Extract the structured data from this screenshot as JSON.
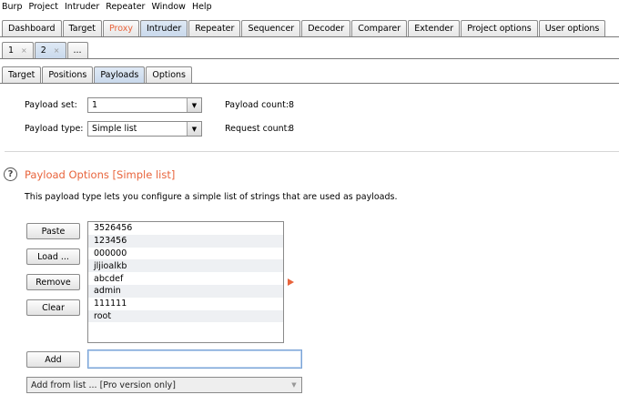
{
  "menu": [
    "Burp",
    "Project",
    "Intruder",
    "Repeater",
    "Window",
    "Help"
  ],
  "main_tabs": [
    "Dashboard",
    "Target",
    "Proxy",
    "Intruder",
    "Repeater",
    "Sequencer",
    "Decoder",
    "Comparer",
    "Extender",
    "Project options",
    "User options"
  ],
  "sub_tabs": [
    {
      "label": "1",
      "close": "×"
    },
    {
      "label": "2",
      "close": "×"
    },
    {
      "label": "..."
    }
  ],
  "inner_tabs": [
    "Target",
    "Positions",
    "Payloads",
    "Options"
  ],
  "payload_set": {
    "label": "Payload set:",
    "value": "1"
  },
  "payload_type": {
    "label": "Payload type:",
    "value": "Simple list"
  },
  "payload_count": {
    "label": "Payload count:",
    "value": "8"
  },
  "request_count": {
    "label": "Request count:",
    "value": "8"
  },
  "section": {
    "help_glyph": "?",
    "title": "Payload Options [Simple list]",
    "description": "This payload type lets you configure a simple list of strings that are used as payloads."
  },
  "buttons": {
    "paste": "Paste",
    "load": "Load ...",
    "remove": "Remove",
    "clear": "Clear",
    "add": "Add"
  },
  "payloads": [
    "3526456",
    "123456",
    "000000",
    "jljioalkb",
    "abcdef",
    "admin",
    "111111",
    "root"
  ],
  "add_input": {
    "value": ""
  },
  "add_from_list": "Add from list ... [Pro version only]",
  "colors": {
    "accent": "#e8643c",
    "selected_tab": "#c9d9ec"
  }
}
